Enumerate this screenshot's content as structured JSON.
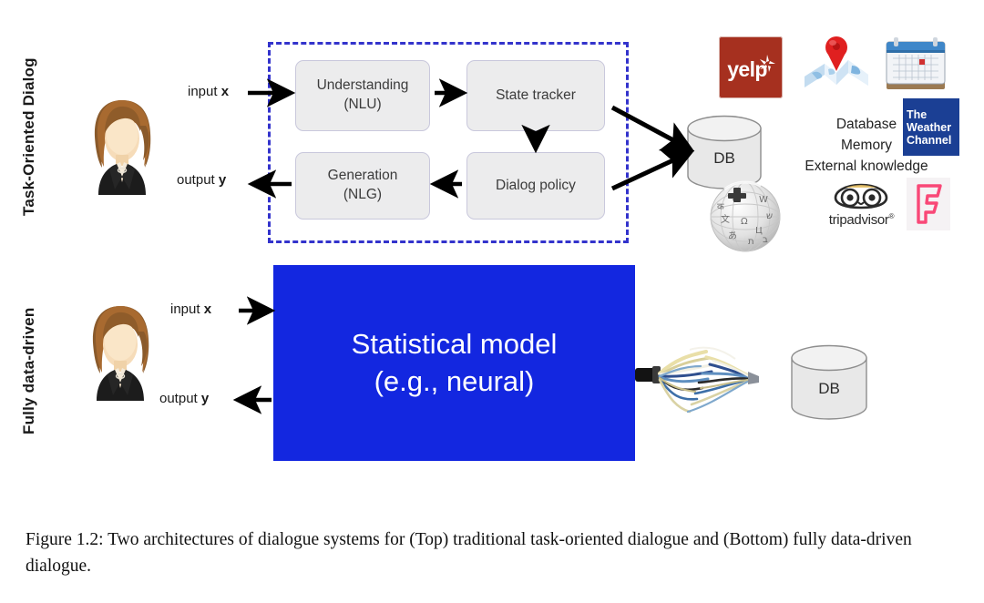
{
  "figure": {
    "caption": "Figure 1.2: Two architectures of dialogue systems for (Top) traditional task-oriented dialogue and (Bottom) fully data-driven dialogue."
  },
  "rows": {
    "top_label": "Task-Oriented Dialog",
    "bottom_label": "Fully data-driven"
  },
  "top_diagram": {
    "io": {
      "input_label": "input x",
      "input_text": "input ",
      "input_var": "x",
      "output_text": "output ",
      "output_var": "y",
      "output_label": "output y"
    },
    "boxes": {
      "nlu_line1": "Understanding",
      "nlu_line2": "(NLU)",
      "state_tracker": "State tracker",
      "nlg_line1": "Generation",
      "nlg_line2": "(NLG)",
      "dialog_policy": "Dialog policy"
    },
    "db_label": "DB",
    "knowledge": [
      "Database",
      "Memory",
      "External knowledge"
    ],
    "logos": [
      {
        "name": "yelp-logo",
        "text": "yelp",
        "color": "#a6301f"
      },
      {
        "name": "google-maps-logo",
        "text": "",
        "color": "#cfe4f5"
      },
      {
        "name": "calendar-logo",
        "text": "",
        "color": "#3f87c9"
      },
      {
        "name": "weather-channel-logo",
        "line1": "The",
        "line2": "Weather",
        "line3": "Channel",
        "color": "#1b3f94"
      },
      {
        "name": "wikipedia-globe-logo",
        "text": "",
        "color": "#d8d8d8"
      },
      {
        "name": "tripadvisor-logo",
        "text": "tripadvisor",
        "registered": "®",
        "color": "#2a2a2a"
      },
      {
        "name": "foursquare-logo",
        "text": "F",
        "color": "#f94877"
      }
    ]
  },
  "bottom_diagram": {
    "model_line1": "Statistical model",
    "model_line2": "(e.g., neural)",
    "model_color": "#1327e0",
    "db_label": "DB",
    "io": {
      "input_text": "input ",
      "input_var": "x",
      "output_text": "output ",
      "output_var": "y"
    }
  },
  "colors": {
    "dashed_border": "#3333cc",
    "box_fill": "#ececed",
    "box_border": "#c9c8dc",
    "model_blue": "#1327e0",
    "arrow": "#000000"
  }
}
